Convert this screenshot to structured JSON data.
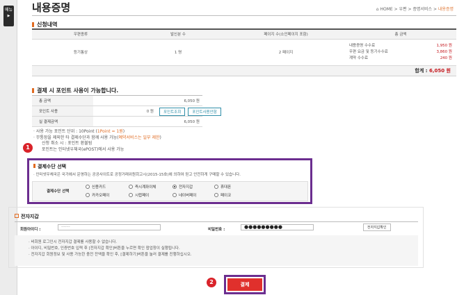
{
  "side_tab": {
    "label": "메뉴"
  },
  "page": {
    "title": "내용증명"
  },
  "breadcrumb": {
    "home": "HOME",
    "items": [
      "우편",
      "증명서비스",
      "내용증명"
    ]
  },
  "application": {
    "section_title": "신청내역",
    "headers": [
      "우편종류",
      "발신분 수",
      "페이지 수(소인페이지 포함)",
      "총 금액"
    ],
    "row": {
      "type": "등기통상",
      "count": "1 명",
      "pages": "2 페이지"
    },
    "fees": [
      {
        "name": "내용증명 수수료",
        "value": "1,950 원"
      },
      {
        "name": "우편 요금 및 등기수수료",
        "value": "3,860 원"
      },
      {
        "name": "계약 수수료",
        "value": "240 원"
      }
    ],
    "total_label": "합계 :",
    "total_value": "6,050 원"
  },
  "points": {
    "section_title": "결제 시 포인트 사용이 가능합니다.",
    "rows": [
      {
        "label": "총 금액",
        "value": "6,050 원"
      },
      {
        "label": "포인트 사용",
        "value": "0 원"
      },
      {
        "label": "실 결제금액",
        "value": "6,050 원"
      }
    ],
    "lookup_button": "포인트조회",
    "usage_button": "포인트사용안함"
  },
  "notes": [
    {
      "text": "사용 가능 포인트 단위 : 10Point (",
      "hl": "1Point = 1원",
      "tail": ")"
    },
    {
      "text": "무통장을 제외한 타 결제수단과 함께 사용 가능(",
      "hl": "예약서비스는 일부 제한",
      "tail": ")"
    },
    {
      "text": "신청 취소 시 : 포인트 환불됨",
      "hl": "",
      "tail": ""
    },
    {
      "text": "포인트는 인터넷우체국(ePOST)에서 사용 가능",
      "hl": "",
      "tail": ""
    }
  ],
  "payment": {
    "section_title": "결제수단 선택",
    "note": "인터넷우체국은 국가에서 운영하는 공공사이트로 공정거래위원회고시(2015-15호)에 의하여 믿고 안전하게 구매할 수 있습니다.",
    "method_label": "결제수단 선택",
    "options": [
      "신용카드",
      "즉시계좌이체",
      "전자지갑",
      "휴대폰",
      "카카오페이",
      "시럽페이",
      "네이버페이",
      "페이코"
    ],
    "selected": "전자지갑"
  },
  "wallet": {
    "title": "전자지갑",
    "member_label": "회원아이디 :",
    "member_value": "-------",
    "pw_label": "비밀번호 :",
    "pw_value": "●●●●●●●●●",
    "confirm_button": "전자지갑확인",
    "info": [
      "비회원 로그인시 전자지갑 결제를 사용할 수 없습니다.",
      "아이디, 비밀번호, 인증번호 입력 후 [전자지갑 확인]버튼을 누르면 확인 팝업창이 실행됩니다.",
      "전자지갑 회원정보 및 사용 가능한 충전 잔액을 확인 후, [결제하기]버튼을 눌러 결제를 진행하십시오."
    ]
  },
  "pay_button": {
    "label": "결제"
  },
  "annotations": {
    "badge1": "1",
    "badge2": "2"
  },
  "colors": {
    "accent": "#e06a20",
    "red": "#c4161c",
    "highlight_box": "#6b2d8f",
    "pay_button": "#e0302c"
  }
}
